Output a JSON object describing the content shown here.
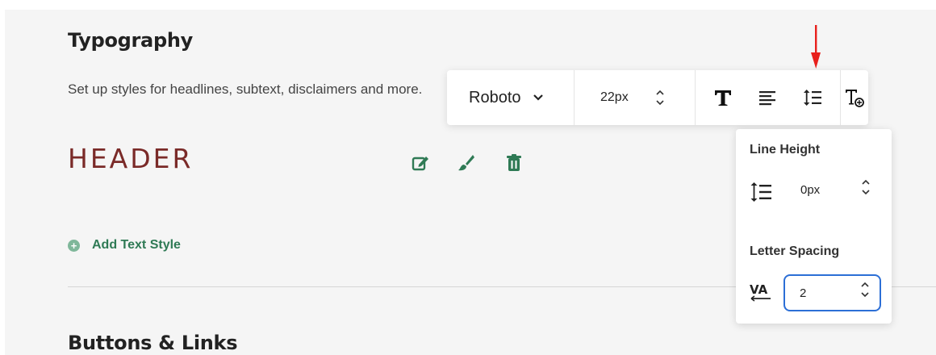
{
  "typography": {
    "title": "Typography",
    "subtitle": "Set up styles for headlines, subtext, disclaimers and more.",
    "header_sample": "HEADER",
    "add_style_label": "Add Text Style"
  },
  "toolbar": {
    "font_family": "Roboto",
    "font_size": "22px"
  },
  "line_height_popover": {
    "line_height_label": "Line Height",
    "line_height_value": "0px",
    "letter_spacing_label": "Letter Spacing",
    "letter_spacing_value": "2"
  },
  "buttons_links": {
    "title": "Buttons & Links"
  },
  "colors": {
    "accent_green": "#2f7a55",
    "header_red": "#7a2a28",
    "focus_blue": "#2c6fd6",
    "arrow_red": "#e8201c"
  }
}
